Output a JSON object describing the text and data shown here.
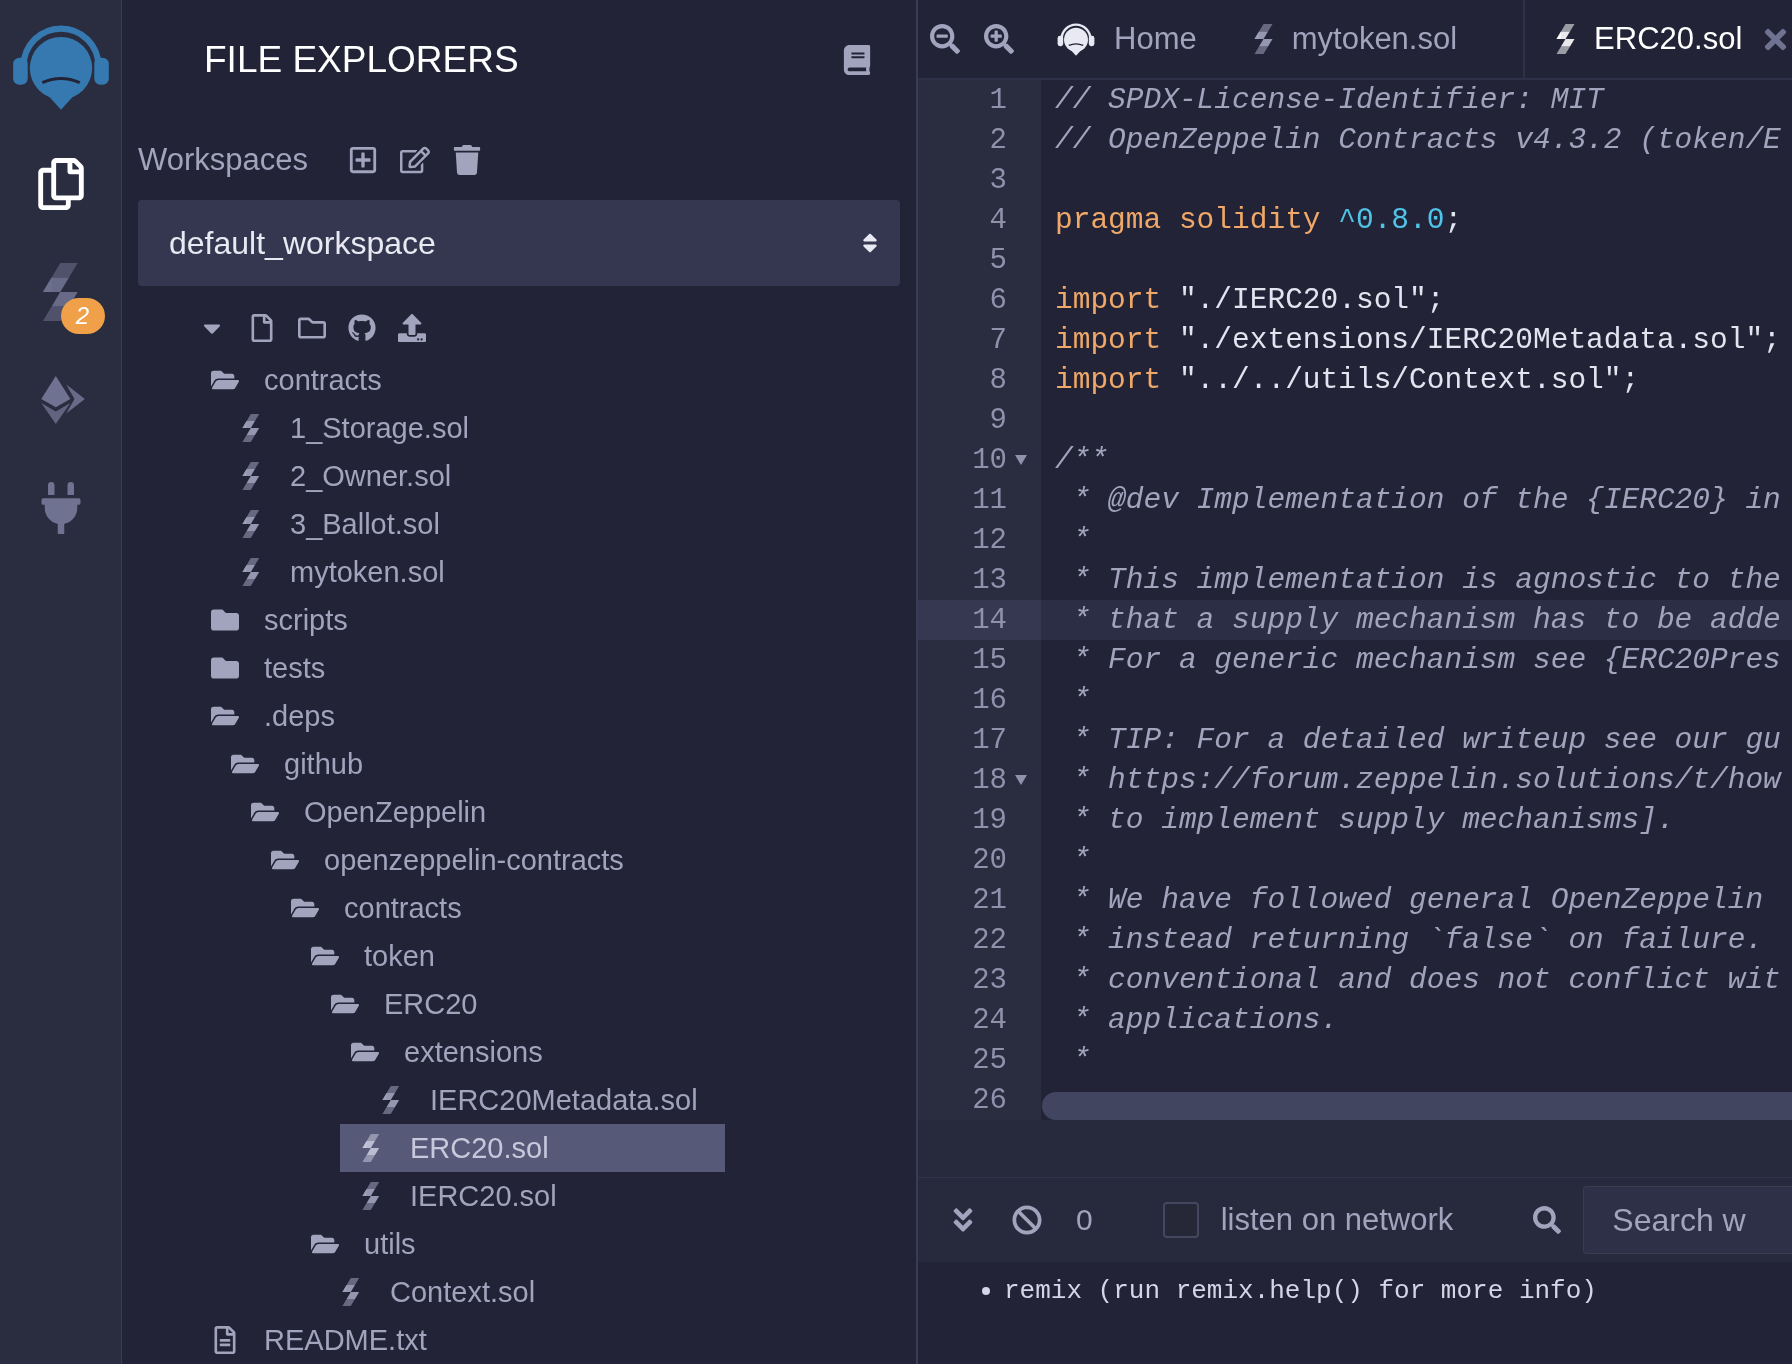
{
  "sidebar": {
    "items": [
      {
        "kind": "files",
        "selected": true
      },
      {
        "kind": "solidity",
        "selected": false,
        "badge": "2"
      },
      {
        "kind": "deploy",
        "selected": false
      },
      {
        "kind": "plugin",
        "selected": false
      }
    ]
  },
  "explorer": {
    "title": "FILE EXPLORERS",
    "workspaces_label": "Workspaces",
    "workspace": "default_workspace",
    "tree_expanded": true,
    "tree": [
      {
        "kind": "folder",
        "name": "contracts",
        "expanded": true,
        "selected": false,
        "children": [
          {
            "kind": "sol",
            "name": "1_Storage.sol",
            "selected": false
          },
          {
            "kind": "sol",
            "name": "2_Owner.sol",
            "selected": false
          },
          {
            "kind": "sol",
            "name": "3_Ballot.sol",
            "selected": false
          },
          {
            "kind": "sol",
            "name": "mytoken.sol",
            "selected": false
          }
        ]
      },
      {
        "kind": "folder",
        "name": "scripts",
        "expanded": false,
        "selected": false
      },
      {
        "kind": "folder",
        "name": "tests",
        "expanded": false,
        "selected": false
      },
      {
        "kind": "folder",
        "name": ".deps",
        "expanded": true,
        "selected": false,
        "children": [
          {
            "kind": "folder",
            "name": "github",
            "expanded": true,
            "selected": false,
            "children": [
              {
                "kind": "folder",
                "name": "OpenZeppelin",
                "expanded": true,
                "selected": false,
                "children": [
                  {
                    "kind": "folder",
                    "name": "openzeppelin-contracts",
                    "expanded": true,
                    "selected": false,
                    "children": [
                      {
                        "kind": "folder",
                        "name": "contracts",
                        "expanded": true,
                        "selected": false,
                        "children": [
                          {
                            "kind": "folder",
                            "name": "token",
                            "expanded": true,
                            "selected": false,
                            "children": [
                              {
                                "kind": "folder",
                                "name": "ERC20",
                                "expanded": true,
                                "selected": false,
                                "children": [
                                  {
                                    "kind": "folder",
                                    "name": "extensions",
                                    "expanded": true,
                                    "selected": false,
                                    "children": [
                                      {
                                        "kind": "sol",
                                        "name": "IERC20Metadata.sol",
                                        "selected": false
                                      }
                                    ]
                                  },
                                  {
                                    "kind": "sol",
                                    "name": "ERC20.sol",
                                    "selected": true
                                  },
                                  {
                                    "kind": "sol",
                                    "name": "IERC20.sol",
                                    "selected": false
                                  }
                                ]
                              }
                            ]
                          },
                          {
                            "kind": "folder",
                            "name": "utils",
                            "expanded": true,
                            "selected": false,
                            "children": [
                              {
                                "kind": "sol",
                                "name": "Context.sol",
                                "selected": false
                              }
                            ]
                          }
                        ]
                      }
                    ]
                  }
                ]
              }
            ]
          }
        ]
      },
      {
        "kind": "text",
        "name": "README.txt",
        "selected": false
      }
    ]
  },
  "editor": {
    "tabs": [
      {
        "kind": "home",
        "label": "Home",
        "selected": false
      },
      {
        "kind": "file",
        "label": "mytoken.sol",
        "selected": false
      },
      {
        "kind": "file",
        "label": "ERC20.sol",
        "selected": true
      }
    ],
    "lines": [
      {
        "number": "1",
        "foldable": false,
        "active": false,
        "tokens": [
          {
            "kind": "comment",
            "text": "// SPDX-License-Identifier: MIT"
          }
        ]
      },
      {
        "number": "2",
        "foldable": false,
        "active": false,
        "tokens": [
          {
            "kind": "comment",
            "text": "// OpenZeppelin Contracts v4.3.2 (token/E"
          }
        ]
      },
      {
        "number": "3",
        "foldable": false,
        "active": false
      },
      {
        "number": "4",
        "foldable": false,
        "active": false,
        "tokens": [
          {
            "kind": "keyword",
            "text": "pragma solidity "
          },
          {
            "kind": "number",
            "text": "^0.8.0"
          },
          {
            "kind": "plain",
            "text": ";"
          }
        ]
      },
      {
        "number": "5",
        "foldable": false,
        "active": false
      },
      {
        "number": "6",
        "foldable": false,
        "active": false,
        "tokens": [
          {
            "kind": "keyword",
            "text": "import"
          },
          {
            "kind": "plain",
            "text": " \"./IERC20.sol\";"
          }
        ]
      },
      {
        "number": "7",
        "foldable": false,
        "active": false,
        "tokens": [
          {
            "kind": "keyword",
            "text": "import"
          },
          {
            "kind": "plain",
            "text": " \"./extensions/IERC20Metadata.sol\";"
          }
        ]
      },
      {
        "number": "8",
        "foldable": false,
        "active": false,
        "tokens": [
          {
            "kind": "keyword",
            "text": "import"
          },
          {
            "kind": "plain",
            "text": " \"../../utils/Context.sol\";"
          }
        ]
      },
      {
        "number": "9",
        "foldable": false,
        "active": false
      },
      {
        "number": "10",
        "foldable": true,
        "active": false,
        "tokens": [
          {
            "kind": "comment",
            "text": "/**"
          }
        ]
      },
      {
        "number": "11",
        "foldable": false,
        "active": false,
        "tokens": [
          {
            "kind": "comment",
            "text": " * @dev Implementation of the {IERC20} in"
          }
        ]
      },
      {
        "number": "12",
        "foldable": false,
        "active": false,
        "tokens": [
          {
            "kind": "comment",
            "text": " *"
          }
        ]
      },
      {
        "number": "13",
        "foldable": false,
        "active": false,
        "tokens": [
          {
            "kind": "comment",
            "text": " * This implementation is agnostic to the"
          }
        ]
      },
      {
        "number": "14",
        "foldable": false,
        "active": true,
        "tokens": [
          {
            "kind": "comment",
            "text": " * that a supply mechanism has to be adde"
          }
        ]
      },
      {
        "number": "15",
        "foldable": false,
        "active": false,
        "tokens": [
          {
            "kind": "comment",
            "text": " * For a generic mechanism see {ERC20Pres"
          }
        ]
      },
      {
        "number": "16",
        "foldable": false,
        "active": false,
        "tokens": [
          {
            "kind": "comment",
            "text": " *"
          }
        ]
      },
      {
        "number": "17",
        "foldable": false,
        "active": false,
        "tokens": [
          {
            "kind": "comment",
            "text": " * TIP: For a detailed writeup see our gu"
          }
        ]
      },
      {
        "number": "18",
        "foldable": true,
        "active": false,
        "tokens": [
          {
            "kind": "comment",
            "text": " * https://forum.zeppelin.solutions/t/how"
          }
        ]
      },
      {
        "number": "19",
        "foldable": false,
        "active": false,
        "tokens": [
          {
            "kind": "comment",
            "text": " * to implement supply mechanisms]."
          }
        ]
      },
      {
        "number": "20",
        "foldable": false,
        "active": false,
        "tokens": [
          {
            "kind": "comment",
            "text": " *"
          }
        ]
      },
      {
        "number": "21",
        "foldable": false,
        "active": false,
        "tokens": [
          {
            "kind": "comment",
            "text": " * We have followed general OpenZeppelin"
          }
        ]
      },
      {
        "number": "22",
        "foldable": false,
        "active": false,
        "tokens": [
          {
            "kind": "comment",
            "text": " * instead returning `false` on failure."
          }
        ]
      },
      {
        "number": "23",
        "foldable": false,
        "active": false,
        "tokens": [
          {
            "kind": "comment",
            "text": " * conventional and does not conflict wit"
          }
        ]
      },
      {
        "number": "24",
        "foldable": false,
        "active": false,
        "tokens": [
          {
            "kind": "comment",
            "text": " * applications."
          }
        ]
      },
      {
        "number": "25",
        "foldable": false,
        "active": false,
        "tokens": [
          {
            "kind": "comment",
            "text": " *"
          }
        ]
      },
      {
        "number": "26",
        "foldable": false,
        "active": false
      }
    ]
  },
  "terminal": {
    "count": "0",
    "listen_checked": false,
    "listen_label": "listen on network",
    "search_placeholder": "Search w",
    "output": [
      "remix (run remix.help() for more info)"
    ]
  }
}
